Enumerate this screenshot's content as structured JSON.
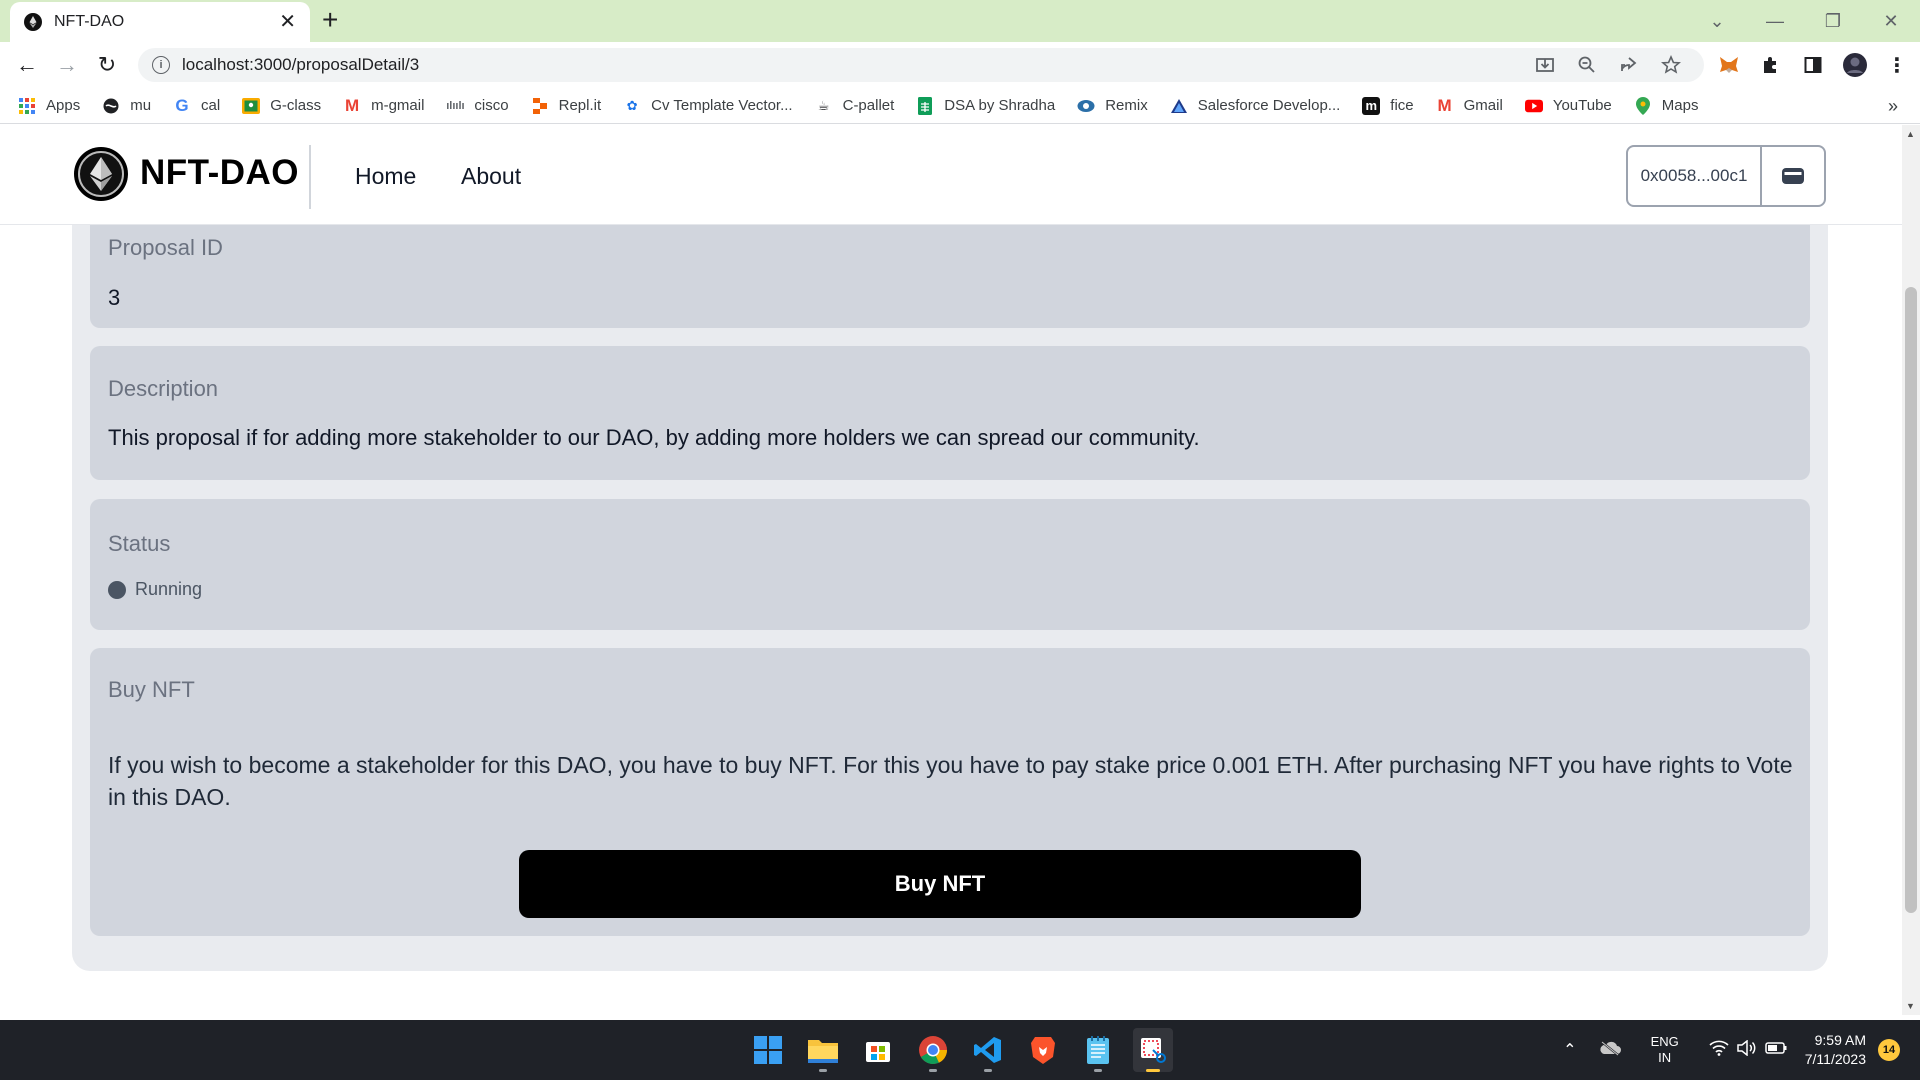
{
  "browser": {
    "tab_title": "NFT-DAO",
    "url": "localhost:3000/proposalDetail/3",
    "bookmarks": [
      {
        "label": "Apps",
        "icon": "apps-grid-icon"
      },
      {
        "label": "mu",
        "icon": "globe-icon"
      },
      {
        "label": "cal",
        "icon": "google-icon"
      },
      {
        "label": "G-class",
        "icon": "classroom-icon"
      },
      {
        "label": "m-gmail",
        "icon": "gmail-icon"
      },
      {
        "label": "cisco",
        "icon": "cisco-icon"
      },
      {
        "label": "Repl.it",
        "icon": "replit-icon"
      },
      {
        "label": "Cv Template Vector...",
        "icon": "cv-template-icon"
      },
      {
        "label": "C-pallet",
        "icon": "cup-icon"
      },
      {
        "label": "DSA by Shradha",
        "icon": "sheets-icon"
      },
      {
        "label": "Remix",
        "icon": "remix-icon"
      },
      {
        "label": "Salesforce Develop...",
        "icon": "salesforce-icon"
      },
      {
        "label": "fice",
        "icon": "m-icon"
      },
      {
        "label": "Gmail",
        "icon": "gmail-icon"
      },
      {
        "label": "YouTube",
        "icon": "youtube-icon"
      },
      {
        "label": "Maps",
        "icon": "maps-pin-icon"
      }
    ],
    "bookmarks_more": "»"
  },
  "app": {
    "brand": "NFT-DAO",
    "nav": [
      "Home",
      "About"
    ],
    "wallet_address": "0x0058...00c1"
  },
  "proposal": {
    "id_label": "Proposal ID",
    "id_value": "3",
    "description_label": "Description",
    "description_value": "This proposal if for adding more stakeholder to our DAO, by adding more holders we can spread our community.",
    "status_label": "Status",
    "status_value": "Running",
    "buy_label": "Buy NFT",
    "buy_text": "If you wish to become a stakeholder for this DAO, you have to buy NFT. For this you have to pay stake price 0.001 ETH. After purchasing NFT you have rights to Vote in this DAO.",
    "buy_button": "Buy NFT"
  },
  "taskbar": {
    "lang_top": "ENG",
    "lang_bottom": "IN",
    "time": "9:59 AM",
    "date": "7/11/2023",
    "notification_count": "14"
  }
}
